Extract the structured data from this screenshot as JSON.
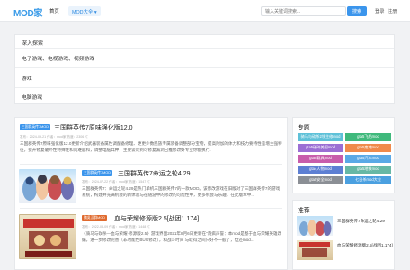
{
  "header": {
    "logo": "MOD家",
    "nav_home": "首页",
    "nav_more": "MOD大全 ▾",
    "search_placeholder": "输入关键词搜索...",
    "search_button": "搜索",
    "login": "登录",
    "register": "注册"
  },
  "explore": {
    "title": "深入探索",
    "items": [
      "电子游戏、电视游戏、视频游戏",
      "游戏",
      "电脑游戏"
    ]
  },
  "articles": [
    {
      "tag": "三国群英传7MOD",
      "title": "三国群英传7原味强化版12.0",
      "meta": "发布：2024-09-21   作者：mod家   热度：2306 ℃",
      "desc": "三国群英传7原味强化版12.0更新介绍武器装备属性调配备修理、更更少数民族专属装备调整部分宝物，提高附加的体力和技力要特性鉴增主强特征，提升修复破坏性特殊性和问难题和，调整电脑兵种，主要谈论到可修复漏洞已推修改好专业你都执行."
    },
    {
      "tag": "三国群英传7MOD",
      "title": "三国群英传7命运之轮4.29",
      "meta": "发布：2024-07-22   作者：mod家   热度：1547 ℃",
      "desc": "三国群英传7：命运之轮4.29是热门单机三国群英传7的一款MOD。该修改游戏在旧版对了三国群英传7的游戏系统，构建并充满机会的新体验与在随游中的修改的可能性中，更多机会与乐趣，在此版本中..."
    },
    {
      "tag": "魏吳汉群MOD",
      "title": "血与荣耀修源版2.5[战团1.174]",
      "meta": "发布：2022-08-09   作者：mod家   热度：1448 ℃",
      "desc": "《骑马与砍杀—血与荣耀·修源版2.5》游戏界面2021年8月6日更新在\"骁疯声誉：本mod是基于血与荣耀英雄改编，进一步修改完善（非功能性BUG修改），和战斗时间 与取得之间只好不一般了，但还mod..."
    }
  ],
  "sidebar": {
    "topics_title": "专题",
    "topics": [
      {
        "label": "骑马与砍杀2领主修mod",
        "color": "#5ec1d8"
      },
      {
        "label": "gta5飞船mod",
        "color": "#3fb97c"
      },
      {
        "label": "gta5破碎美国mod",
        "color": "#9b6fd4"
      },
      {
        "label": "gta5鬼魂mod",
        "color": "#f08a4b"
      },
      {
        "label": "gta5载具mod",
        "color": "#c85dab"
      },
      {
        "label": "gta5汽车mod",
        "color": "#5aa9e6"
      },
      {
        "label": "gta4人物mod",
        "color": "#5d7fd3"
      },
      {
        "label": "gta5地铁mod",
        "color": "#67b8a5"
      },
      {
        "label": "gta5安全mod",
        "color": "#8b8f95"
      },
      {
        "label": "七日杀mod大全",
        "color": "#4ba0e0"
      }
    ],
    "recommend_title": "推荐",
    "recommend": [
      {
        "title": "三国群英传7命运之轮4.29"
      },
      {
        "title": "血与荣耀修源版2.5[战团1.174]"
      }
    ]
  }
}
